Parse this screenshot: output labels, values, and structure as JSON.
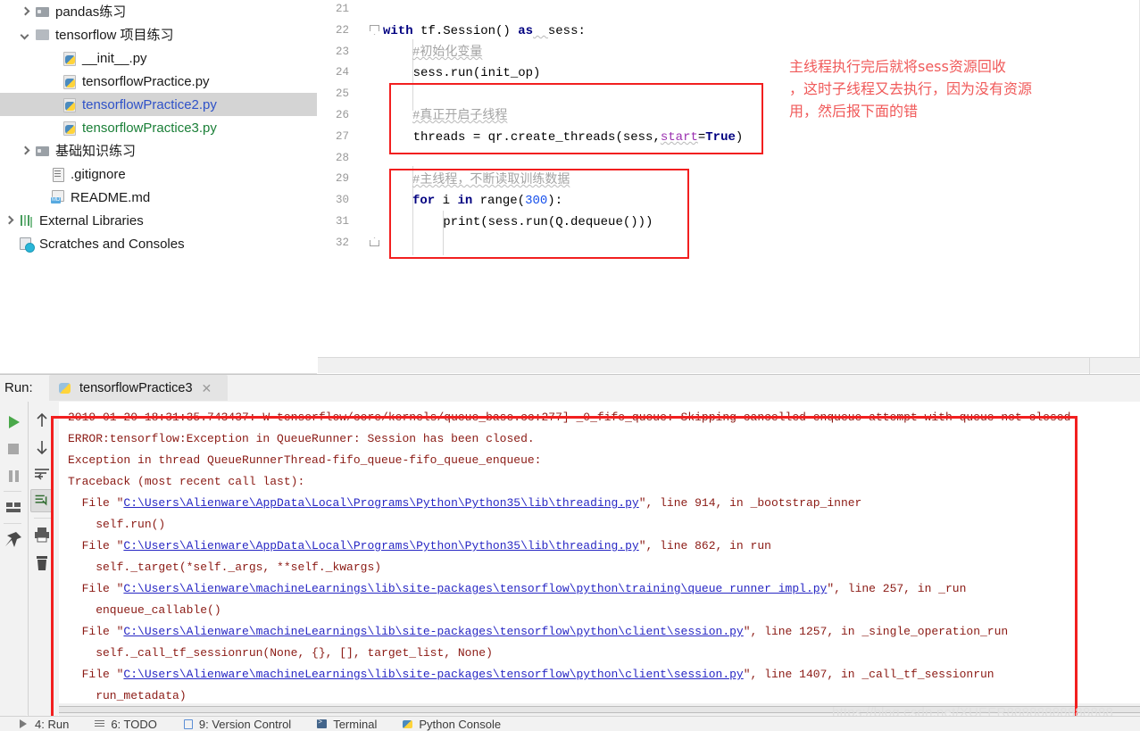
{
  "sidebar": {
    "items": [
      {
        "label": "pandas练习",
        "kind": "folder",
        "indent": "indent-1",
        "arrow": "right",
        "color": "lbl-black",
        "selected": false
      },
      {
        "label": "tensorflow 项目练习",
        "kind": "folder-open",
        "indent": "indent-1",
        "arrow": "down",
        "color": "lbl-black",
        "selected": false
      },
      {
        "label": "__init__.py",
        "kind": "py",
        "indent": "indent-2",
        "arrow": "none",
        "color": "lbl-black",
        "selected": false
      },
      {
        "label": "tensorflowPractice.py",
        "kind": "py",
        "indent": "indent-2",
        "arrow": "none",
        "color": "lbl-black",
        "selected": false
      },
      {
        "label": "tensorflowPractice2.py",
        "kind": "py",
        "indent": "indent-2",
        "arrow": "none",
        "color": "lbl-blue",
        "selected": true
      },
      {
        "label": "tensorflowPractice3.py",
        "kind": "py",
        "indent": "indent-2",
        "arrow": "none",
        "color": "lbl-green",
        "selected": false
      },
      {
        "label": "基础知识练习",
        "kind": "folder",
        "indent": "indent-1",
        "arrow": "right",
        "color": "lbl-black",
        "selected": false
      },
      {
        "label": ".gitignore",
        "kind": "txt",
        "indent": "indent-1n",
        "arrow": "none",
        "color": "lbl-black",
        "selected": false
      },
      {
        "label": "README.md",
        "kind": "md",
        "indent": "indent-1n",
        "arrow": "none",
        "color": "lbl-black",
        "selected": false
      },
      {
        "label": "External Libraries",
        "kind": "libs",
        "indent": "indent-0",
        "arrow": "right",
        "color": "lbl-black",
        "selected": false
      },
      {
        "label": "Scratches and Consoles",
        "kind": "scratch",
        "indent": "indent-0",
        "arrow": "none",
        "color": "lbl-black",
        "selected": false
      }
    ]
  },
  "editor": {
    "line_numbers": [
      "21",
      "22",
      "23",
      "24",
      "25",
      "26",
      "27",
      "28",
      "29",
      "30",
      "31",
      "32"
    ],
    "code_lines": [
      {
        "n": "21",
        "text": ""
      },
      {
        "n": "22",
        "text": "with tf.Session() as  sess:"
      },
      {
        "n": "23",
        "text": "    #初始化变量"
      },
      {
        "n": "24",
        "text": "    sess.run(init_op)"
      },
      {
        "n": "25",
        "text": ""
      },
      {
        "n": "26",
        "text": "    #真正开启子线程"
      },
      {
        "n": "27",
        "text": "    threads = qr.create_threads(sess, start=True)"
      },
      {
        "n": "28",
        "text": ""
      },
      {
        "n": "29",
        "text": "    #主线程，不断读取训练数据"
      },
      {
        "n": "30",
        "text": "    for i in range(300):"
      },
      {
        "n": "31",
        "text": "        print(sess.run(Q.dequeue()))"
      },
      {
        "n": "32",
        "text": ""
      }
    ],
    "tokens": {
      "kw_with": "with",
      "kw_as": "as",
      "kw_for": "for",
      "kw_in": "in",
      "kw_true": "True",
      "comment_init": "#初始化变量",
      "comment_start_thread": "#真正开启子线程",
      "comment_main_thread": "#主线程，不断读取训练数据",
      "sess_line": "tf.Session()",
      "sess_name": "sess:",
      "sess_run_init": "    sess.run(init_op)",
      "threads_assign": "    threads = qr.create_threads(sess,",
      "param_start": "start",
      "eq": "=",
      "close_paren": ")",
      "for_i": " i ",
      "range_call": "range(",
      "range_arg": "300",
      "range_close": "):",
      "print_line": "        print(sess.run(Q.dequeue()))"
    },
    "annotation": "主线程执行完后就将sess资源回收\n，这时子线程又去执行，因为没有资源\n用，然后报下面的错"
  },
  "run_panel": {
    "label": "Run:",
    "tab_name": "tensorflowPractice3",
    "tab_close": "✕",
    "toolbar_left": [
      {
        "name": "run-button",
        "icon": "play"
      },
      {
        "name": "stop-button",
        "icon": "stop"
      },
      {
        "name": "pause-button",
        "icon": "pause"
      },
      {
        "name": "layout-button",
        "icon": "layout"
      },
      {
        "name": "pin-button",
        "icon": "pin"
      }
    ],
    "toolbar_mid": [
      {
        "name": "up-stack-button",
        "icon": "arrow-up"
      },
      {
        "name": "down-stack-button",
        "icon": "arrow-down"
      },
      {
        "name": "soft-wrap-button",
        "icon": "soft-wrap"
      },
      {
        "name": "scroll-to-end-button",
        "icon": "scroll-end",
        "active": true
      },
      {
        "name": "print-button",
        "icon": "printer"
      },
      {
        "name": "clear-all-button",
        "icon": "trash"
      }
    ],
    "console_lines": [
      {
        "segments": [
          {
            "t": "2019-01-20 18:31:35.743437: W tensorflow/core/kernels/queue_base.cc:277] _0_fifo_queue: Skipping cancelled enqueue attempt with queue not closed",
            "link": false
          }
        ]
      },
      {
        "segments": [
          {
            "t": "ERROR:tensorflow:Exception in QueueRunner: Session has been closed.",
            "link": false
          }
        ]
      },
      {
        "segments": [
          {
            "t": "Exception in thread QueueRunnerThread-fifo_queue-fifo_queue_enqueue:",
            "link": false
          }
        ]
      },
      {
        "segments": [
          {
            "t": "Traceback (most recent call last):",
            "link": false
          }
        ]
      },
      {
        "segments": [
          {
            "t": "  File \"",
            "link": false
          },
          {
            "t": "C:\\Users\\Alienware\\AppData\\Local\\Programs\\Python\\Python35\\lib\\threading.py",
            "link": true
          },
          {
            "t": "\", line 914, in _bootstrap_inner",
            "link": false
          }
        ]
      },
      {
        "segments": [
          {
            "t": "    self.run()",
            "link": false
          }
        ]
      },
      {
        "segments": [
          {
            "t": "  File \"",
            "link": false
          },
          {
            "t": "C:\\Users\\Alienware\\AppData\\Local\\Programs\\Python\\Python35\\lib\\threading.py",
            "link": true
          },
          {
            "t": "\", line 862, in run",
            "link": false
          }
        ]
      },
      {
        "segments": [
          {
            "t": "    self._target(*self._args, **self._kwargs)",
            "link": false
          }
        ]
      },
      {
        "segments": [
          {
            "t": "  File \"",
            "link": false
          },
          {
            "t": "C:\\Users\\Alienware\\machineLearnings\\lib\\site-packages\\tensorflow\\python\\training\\queue_runner_impl.py",
            "link": true
          },
          {
            "t": "\", line 257, in _run",
            "link": false
          }
        ]
      },
      {
        "segments": [
          {
            "t": "    enqueue_callable()",
            "link": false
          }
        ]
      },
      {
        "segments": [
          {
            "t": "  File \"",
            "link": false
          },
          {
            "t": "C:\\Users\\Alienware\\machineLearnings\\lib\\site-packages\\tensorflow\\python\\client\\session.py",
            "link": true
          },
          {
            "t": "\", line 1257, in _single_operation_run",
            "link": false
          }
        ]
      },
      {
        "segments": [
          {
            "t": "    self._call_tf_sessionrun(None, {}, [], target_list, None)",
            "link": false
          }
        ]
      },
      {
        "segments": [
          {
            "t": "  File \"",
            "link": false
          },
          {
            "t": "C:\\Users\\Alienware\\machineLearnings\\lib\\site-packages\\tensorflow\\python\\client\\session.py",
            "link": true
          },
          {
            "t": "\", line 1407, in _call_tf_sessionrun",
            "link": false
          }
        ]
      },
      {
        "segments": [
          {
            "t": "    run_metadata)",
            "link": false
          }
        ]
      }
    ]
  },
  "status_bar": {
    "items": [
      {
        "label": "4: Run",
        "icon": "play"
      },
      {
        "label": "6: TODO",
        "icon": "todo"
      },
      {
        "label": "9: Version Control",
        "icon": "vcs"
      },
      {
        "label": "Terminal",
        "icon": "term"
      },
      {
        "label": "Python Console",
        "icon": "pycon"
      }
    ]
  },
  "watermark": "https://blog.csdn.net/XUEER88888888888888",
  "colors": {
    "annotation_red": "#f05a5a",
    "box_red": "#f21f1f",
    "link_blue": "#2727c4",
    "console_text": "#8b1a14",
    "keyword": "#000080",
    "comment_grey": "#a3a3a3",
    "number_blue": "#1750eb",
    "param_purple": "#9b30b0",
    "selected_row": "#d4d4d4",
    "file_blue": "#2f52c8",
    "file_green": "#1a7f37"
  }
}
